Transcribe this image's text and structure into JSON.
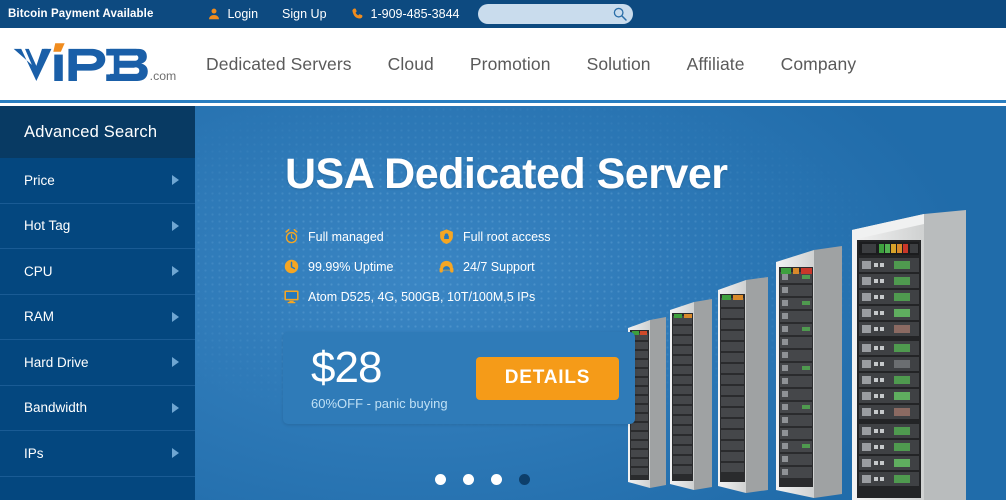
{
  "topbar": {
    "note": "Bitcoin Payment Available",
    "login": "Login",
    "signup": "Sign Up",
    "phone": "1-909-485-3844",
    "user_icon": "user-icon",
    "phone_icon": "phone-icon",
    "search_placeholder": "",
    "search_value": "",
    "search_icon": "search-icon"
  },
  "header": {
    "logo_text": "VIP3",
    "logo_suffix": ".com",
    "nav": [
      {
        "label": "Dedicated Servers"
      },
      {
        "label": "Cloud"
      },
      {
        "label": "Promotion"
      },
      {
        "label": "Solution"
      },
      {
        "label": "Affiliate"
      },
      {
        "label": "Company"
      }
    ]
  },
  "sidebar": {
    "title": "Advanced Search",
    "items": [
      {
        "label": "Price"
      },
      {
        "label": "Hot Tag"
      },
      {
        "label": "CPU"
      },
      {
        "label": "RAM"
      },
      {
        "label": "Hard Drive"
      },
      {
        "label": "Bandwidth"
      },
      {
        "label": "IPs"
      }
    ]
  },
  "banner": {
    "title": "USA Dedicated Server",
    "features": [
      {
        "label": "Full managed",
        "icon": "alarm-clock-icon"
      },
      {
        "label": "Full root access",
        "icon": "shield-icon"
      },
      {
        "label": "99.99% Uptime",
        "icon": "clock-icon"
      },
      {
        "label": "24/7 Support",
        "icon": "headset-icon"
      }
    ],
    "spec": {
      "label": "Atom D525, 4G, 500GB, 10T/100M,5 IPs",
      "icon": "monitor-icon"
    },
    "price": "$28",
    "price_note": "60%OFF - panic buying",
    "details_label": "DETAILS",
    "carousel": {
      "count": 4,
      "active_index": 3
    },
    "image": "server-rack-illustration"
  },
  "colors": {
    "topbar_bg": "#0d4a80",
    "sidebar_bg": "#04477f",
    "sidebar_head_bg": "#083a63",
    "banner_bg": "#2478bd",
    "accent_orange": "#f59b18",
    "nav_text": "#5a5a5a",
    "logo_blue": "#1a5fa8"
  }
}
